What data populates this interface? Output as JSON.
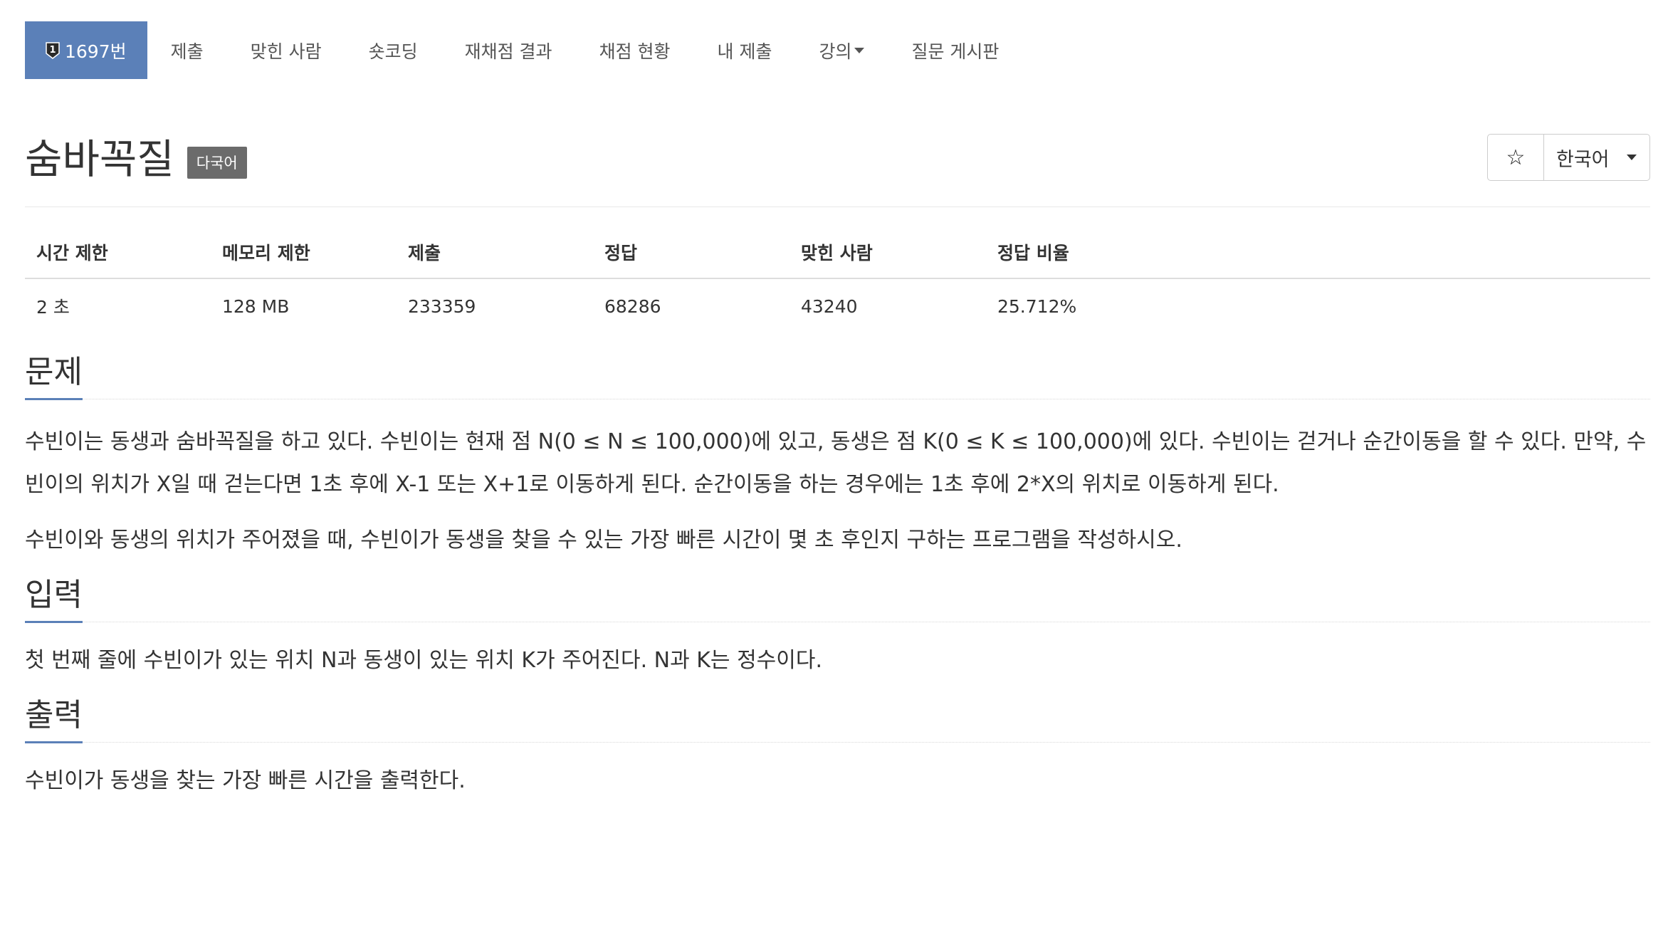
{
  "nav": {
    "items": [
      {
        "label": "1697번",
        "active": true,
        "icon": "ranked-shield-icon"
      },
      {
        "label": "제출"
      },
      {
        "label": "맞힌 사람"
      },
      {
        "label": "숏코딩"
      },
      {
        "label": "재채점 결과"
      },
      {
        "label": "채점 현황"
      },
      {
        "label": "내 제출"
      },
      {
        "label": "강의",
        "dropdown": true
      },
      {
        "label": "질문 게시판"
      }
    ],
    "badge_number": "1"
  },
  "problem": {
    "title": "숨바꼭질",
    "language_badge": "다국어"
  },
  "controls": {
    "star_icon": "☆",
    "language": "한국어"
  },
  "stats": {
    "headers": [
      "시간 제한",
      "메모리 제한",
      "제출",
      "정답",
      "맞힌 사람",
      "정답 비율"
    ],
    "values": [
      "2 초",
      "128 MB",
      "233359",
      "68286",
      "43240",
      "25.712%"
    ]
  },
  "sections": {
    "problem": {
      "title": "문제",
      "paragraphs": [
        "수빈이는 동생과 숨바꼭질을 하고 있다. 수빈이는 현재 점 N(0 ≤ N ≤ 100,000)에 있고, 동생은 점 K(0 ≤ K ≤ 100,000)에 있다. 수빈이는 걷거나 순간이동을 할 수 있다. 만약, 수빈이의 위치가 X일 때 걷는다면 1초 후에 X-1 또는 X+1로 이동하게 된다. 순간이동을 하는 경우에는 1초 후에 2*X의 위치로 이동하게 된다.",
        "수빈이와 동생의 위치가 주어졌을 때, 수빈이가 동생을 찾을 수 있는 가장 빠른 시간이 몇 초 후인지 구하는 프로그램을 작성하시오."
      ]
    },
    "input": {
      "title": "입력",
      "text": "첫 번째 줄에 수빈이가 있는 위치 N과 동생이 있는 위치 K가 주어진다. N과 K는 정수이다."
    },
    "output": {
      "title": "출력",
      "text": "수빈이가 동생을 찾는 가장 빠른 시간을 출력한다."
    }
  },
  "colors": {
    "accent": "#5b80b8",
    "badge_bg": "#6b6b6b"
  }
}
